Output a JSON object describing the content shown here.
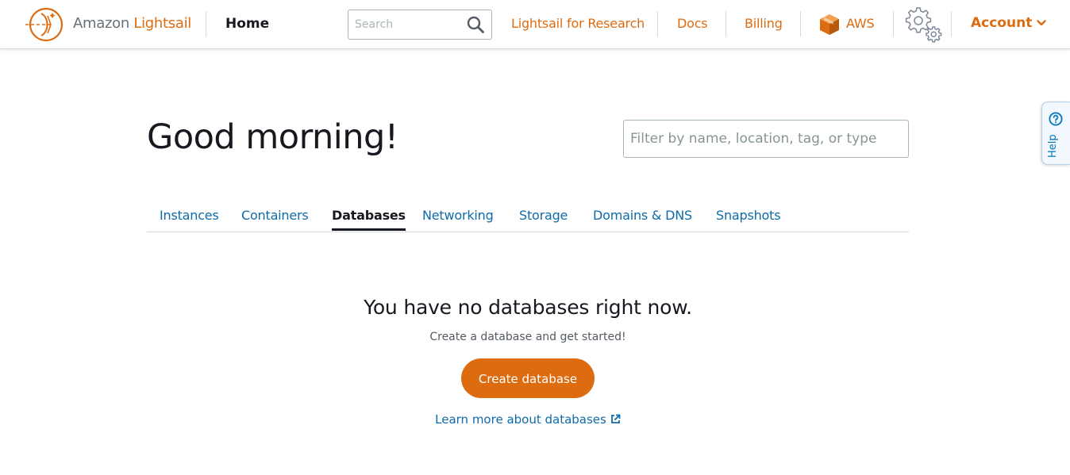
{
  "header": {
    "brand_prefix": "Amazon",
    "brand_name": "Lightsail",
    "home_label": "Home",
    "search_placeholder": "Search",
    "links": {
      "research": "Lightsail for Research",
      "docs": "Docs",
      "billing": "Billing",
      "aws": "AWS"
    },
    "account_label": "Account",
    "icons": {
      "logo": "lightsail-logo",
      "search": "search-icon",
      "aws": "aws-box-icon",
      "settings": "gear-icon",
      "account_menu": "chevron-down-icon"
    }
  },
  "help_tab": {
    "label": "Help",
    "icon": "question-circle-icon"
  },
  "main": {
    "greeting": "Good morning!",
    "filter_placeholder": "Filter by name, location, tag, or type",
    "tabs": [
      {
        "label": "Instances",
        "active": false
      },
      {
        "label": "Containers",
        "active": false
      },
      {
        "label": "Databases",
        "active": true
      },
      {
        "label": "Networking",
        "active": false
      },
      {
        "label": "Storage",
        "active": false
      },
      {
        "label": "Domains & DNS",
        "active": false
      },
      {
        "label": "Snapshots",
        "active": false
      }
    ],
    "empty_state": {
      "title": "You have no databases right now.",
      "subtitle": "Create a database and get started!",
      "button_label": "Create database",
      "learn_more_label": "Learn more about databases",
      "learn_more_icon": "external-link-icon"
    }
  },
  "colors": {
    "brand_orange": "#dd6b10",
    "link_blue": "#0e6ba8",
    "text_dark": "#16191f",
    "text_muted": "#545b64",
    "border": "#d5dbdb"
  }
}
